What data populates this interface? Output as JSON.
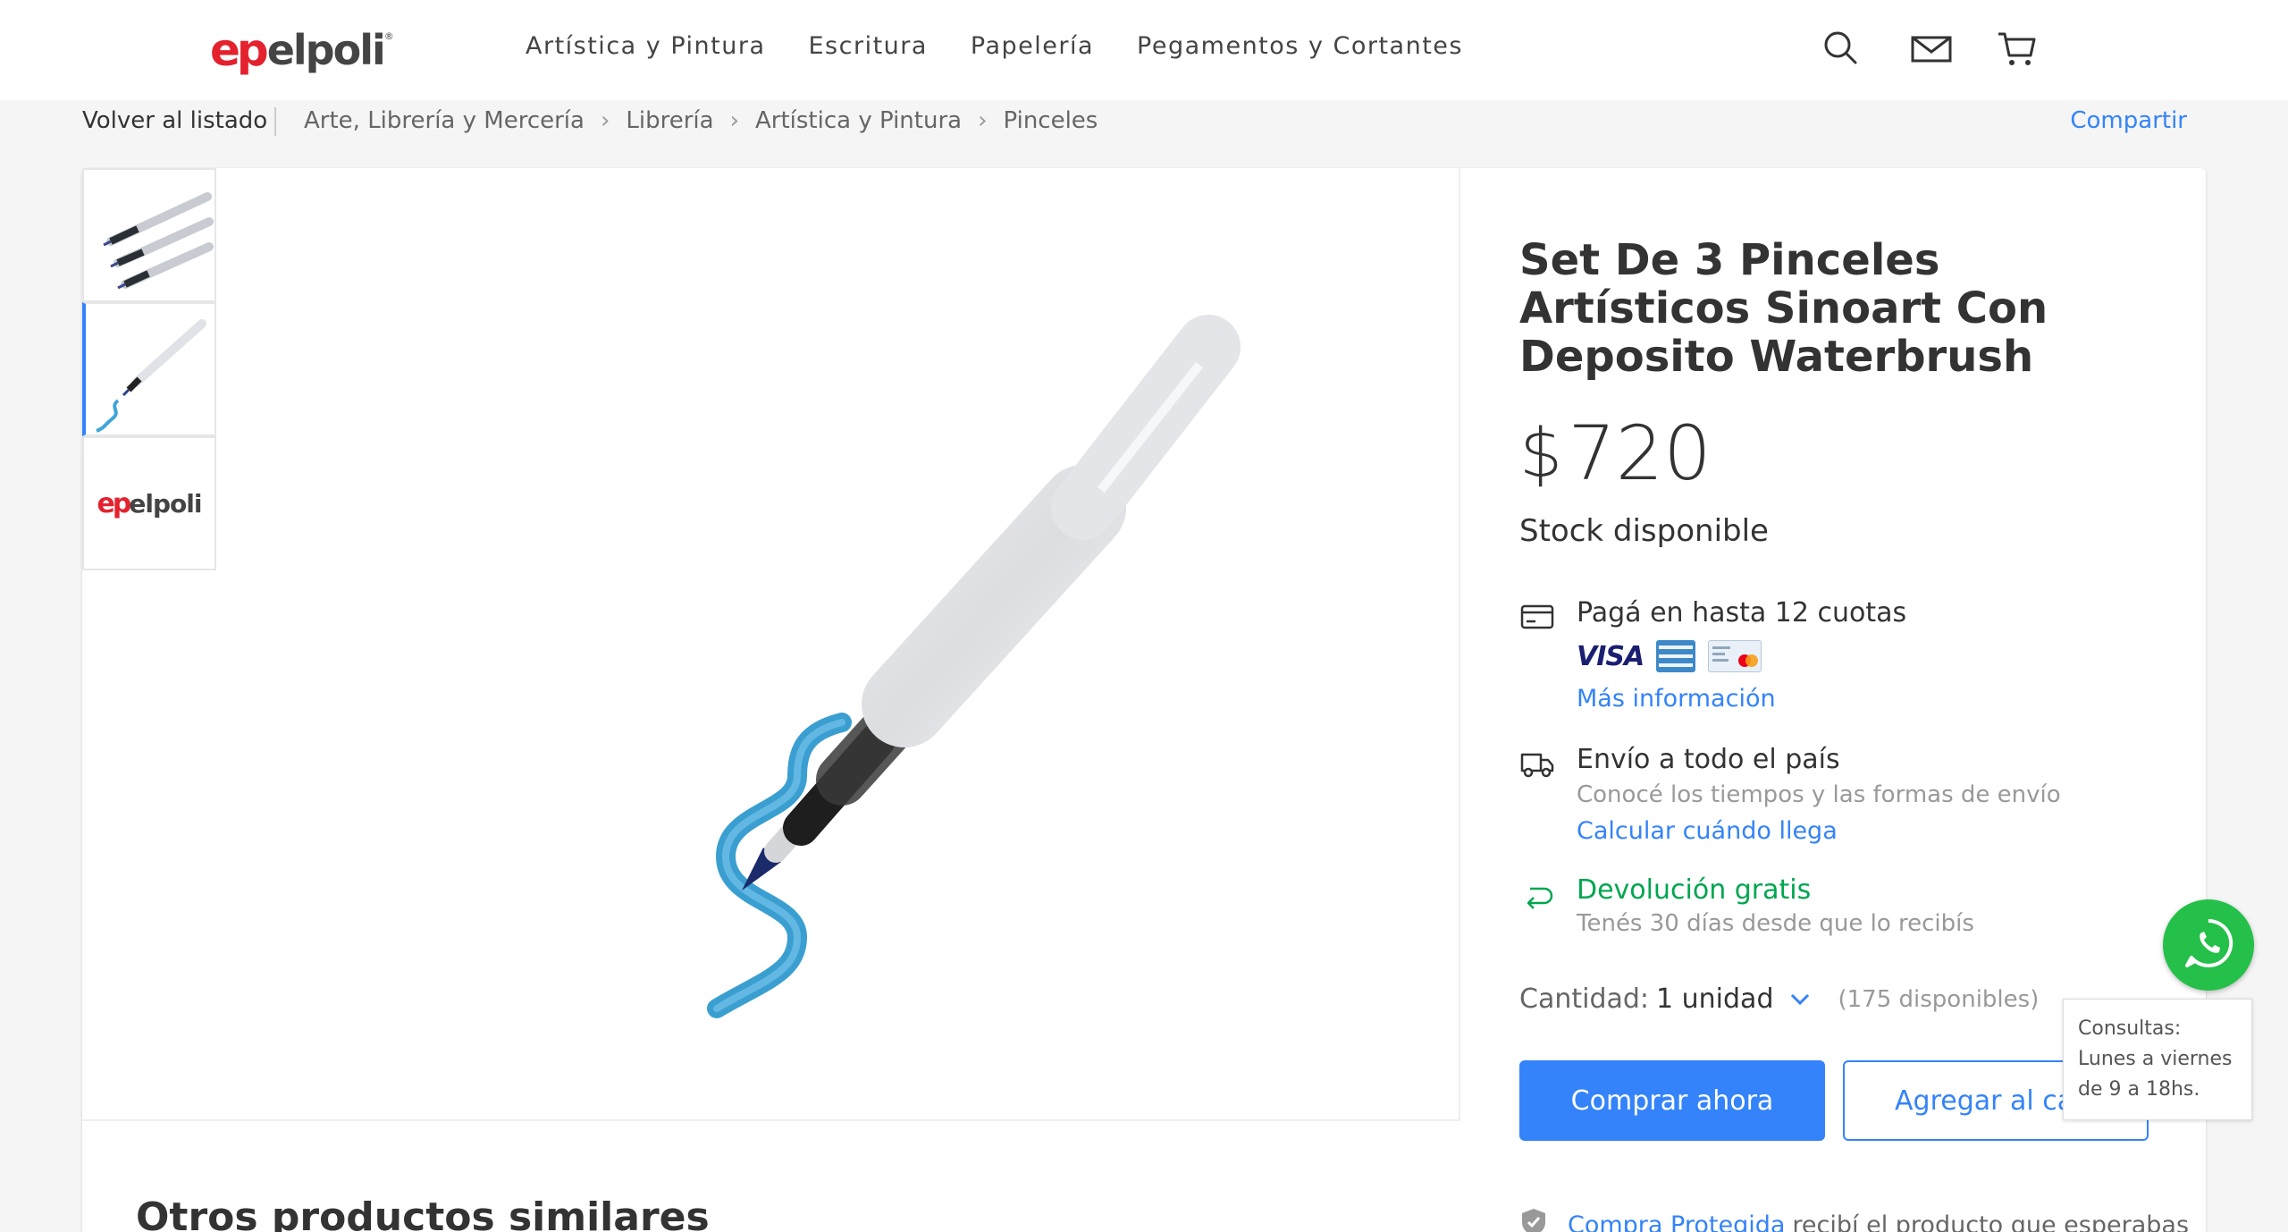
{
  "header": {
    "logo_mark": "ep",
    "logo_text": "elpoli",
    "nav": [
      "Artística y Pintura",
      "Escritura",
      "Papelería",
      "Pegamentos y Cortantes"
    ],
    "icons": [
      "search-icon",
      "mail-icon",
      "cart-icon"
    ]
  },
  "breadcrumb": {
    "back": "Volver al listado",
    "items": [
      "Arte, Librería y Mercería",
      "Librería",
      "Artística y Pintura",
      "Pinceles"
    ],
    "share": "Compartir"
  },
  "gallery": {
    "thumbnails": [
      "brushes-set",
      "single-brush",
      "elpoli-logo"
    ],
    "active_index": 1,
    "thumb_logo_mark": "ep",
    "thumb_logo_text": "elpoli"
  },
  "product": {
    "title": "Set De 3 Pinceles Artísticos Sinoart Con Deposito Waterbrush",
    "currency": "$",
    "price": "720",
    "stock": "Stock disponible"
  },
  "payment": {
    "title": "Pagá en hasta 12 cuotas",
    "visa": "VISA",
    "link": "Más información"
  },
  "shipping": {
    "title": "Envío a todo el país",
    "subtitle": "Conocé los tiempos y las formas de envío",
    "link": "Calcular cuándo llega"
  },
  "returns": {
    "title": "Devolución gratis",
    "subtitle": "Tenés 30 días desde que lo recibís"
  },
  "quantity": {
    "label": "Cantidad:",
    "value": "1 unidad",
    "available": "(175 disponibles)"
  },
  "actions": {
    "buy": "Comprar ahora",
    "cart": "Agregar al carrito"
  },
  "protection": {
    "link": "Compra Protegida",
    "text": "recibí el producto que esperabas"
  },
  "similar": {
    "title": "Otros productos similares"
  },
  "whatsapp": {
    "tooltip": "Consultas: Lunes a viernes de 9 a 18hs."
  },
  "colors": {
    "accent": "#3483fa",
    "brand_red": "#e4222e",
    "green": "#00a650",
    "whatsapp": "#25c04a"
  }
}
